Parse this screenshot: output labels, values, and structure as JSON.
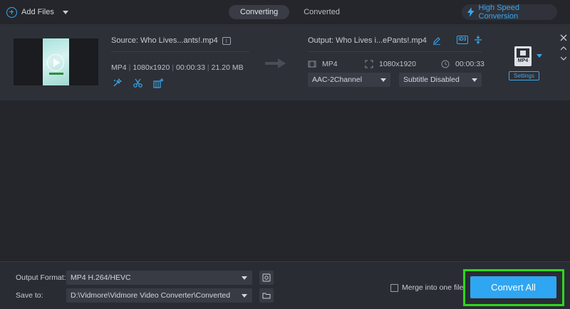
{
  "toolbar": {
    "add_files_label": "Add Files",
    "tabs": [
      {
        "label": "Converting",
        "active": true
      },
      {
        "label": "Converted",
        "active": false
      }
    ],
    "high_speed_label": "High Speed Conversion"
  },
  "file": {
    "source_name": "Source: Who Lives...ants!.mp4",
    "source_format": "MP4",
    "source_resolution": "1080x1920",
    "source_duration": "00:00:33",
    "source_size": "21.20 MB",
    "output_name": "Output: Who Lives i...ePants!.mp4",
    "output_format": "MP4",
    "output_resolution": "1080x1920",
    "output_duration": "00:00:33",
    "audio_track": "AAC-2Channel",
    "subtitle": "Subtitle Disabled",
    "format_badge": "MP4",
    "settings_label": "Settings",
    "info_icon_text": "i",
    "id_icon_text": "ID3"
  },
  "bottom": {
    "output_format_label": "Output Format:",
    "output_format_value": "MP4 H.264/HEVC",
    "save_to_label": "Save to:",
    "save_to_value": "D:\\Vidmore\\Vidmore Video Converter\\Converted",
    "merge_label": "Merge into one file",
    "convert_all_label": "Convert All"
  },
  "colors": {
    "accent": "#2fa6f2",
    "highlight": "#2fd61b",
    "background": "#24262c"
  }
}
